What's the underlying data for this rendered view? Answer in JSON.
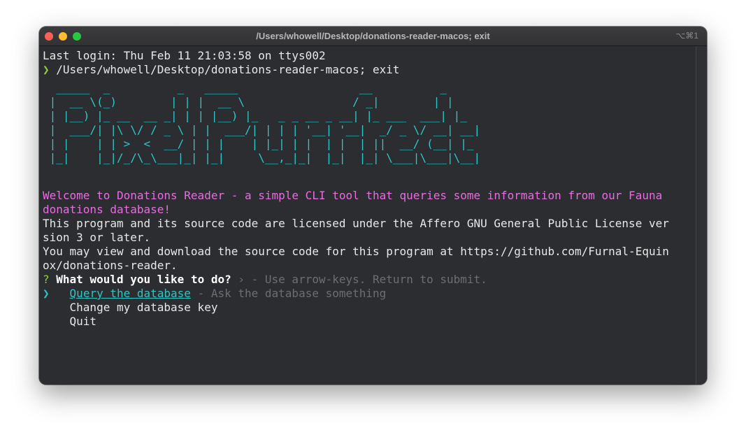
{
  "window": {
    "title": "/Users/whowell/Desktop/donations-reader-macos; exit",
    "shortcut": "⌥⌘1"
  },
  "terminal": {
    "last_login": "Last login: Thu Feb 11 21:03:58 on ttys002",
    "prompt_symbol": "❯",
    "command": " /Users/whowell/Desktop/donations-reader-macos; exit",
    "banner_text": "Pixel Purrfect",
    "ascii_art": "  _____  _          _   _____                  __          _\n |  __ \\(_)        | | |  __ \\                / _|        | |\n | |__) |_ __  __ _| | | |__) |_   _ _ __ _ __| |_ ___  ___| |_\n |  ___/| |\\ \\/ / _ \\ | |  ___/| | | | '__| '__|  _/ _ \\/ __| __|\n | |    | | >  <  __/ | | |    | |_| | |  | |  | ||  __/ (__| |_\n |_|    |_|/_/\\_\\___|_| |_|     \\__,_|_|  |_|  |_| \\___|\\___|\\__|",
    "welcome_line1": "Welcome to Donations Reader - a simple CLI tool that queries some information from our Fauna",
    "welcome_line2": "donations database!",
    "license_line1": "This program and its source code are licensed under the Affero GNU General Public License ver",
    "license_line2": "sion 3 or later.",
    "source_line1": "You may view and download the source code for this program at https://github.com/Furnal-Equin",
    "source_line2": "ox/donations-reader.",
    "question_mark": "?",
    "question": "What would you like to do?",
    "hint": " › - Use arrow-keys. Return to submit.",
    "cursor": "❯",
    "options": [
      {
        "label": "Query the database",
        "description": " - Ask the database something"
      },
      {
        "label": "Change my database key"
      },
      {
        "label": "Quit"
      }
    ]
  },
  "colors": {
    "background": "#2c2d30",
    "text": "#e8e8e8",
    "accent_cyan": "#2fc6c6",
    "welcome_pink": "#e76de0",
    "prompt_green": "#8fd13c",
    "muted": "#6d6e71"
  }
}
